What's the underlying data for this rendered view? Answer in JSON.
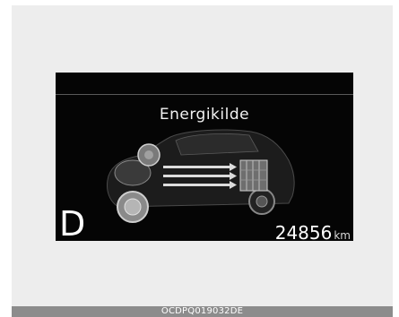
{
  "display": {
    "title": "Energikilde",
    "gear": "D",
    "odometer_value": "24856",
    "odometer_unit": "km"
  },
  "caption": {
    "code": "OCDPQ019032DE"
  },
  "illustration": {
    "car_icon": "car-energy-flow-icon",
    "battery_icon": "battery-icon",
    "arrow_icon": "arrow-right-icon"
  }
}
